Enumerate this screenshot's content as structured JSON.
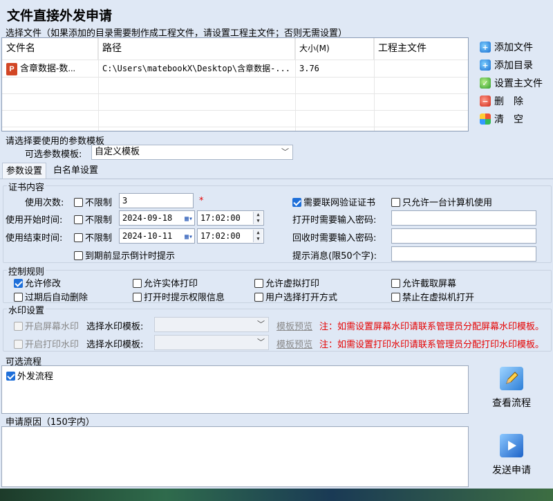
{
  "window": {
    "title": "文件直接外发申请"
  },
  "select_file": {
    "label": "选择文件（如果添加的目录需要制作成工程文件，请设置工程主文件；否则无需设置）",
    "columns": [
      "文件名",
      "路径",
      "大小(M)",
      "工程主文件"
    ],
    "rows": [
      {
        "name": "含章数据-数...",
        "path": "C:\\Users\\matebookX\\Desktop\\含章数据-...",
        "size": "3.76",
        "main": ""
      }
    ],
    "file_icon_letter": "P",
    "buttons": [
      {
        "label": "添加文件",
        "icon": "add-file-icon"
      },
      {
        "label": "添加目录",
        "icon": "add-folder-icon"
      },
      {
        "label": "设置主文件",
        "icon": "set-main-file-icon"
      },
      {
        "label": "删　除",
        "icon": "delete-icon"
      },
      {
        "label": "清　空",
        "icon": "clear-icon"
      }
    ]
  },
  "template": {
    "section_label": "请选择要使用的参数模板",
    "label": "可选参数模板:",
    "value": "自定义模板"
  },
  "tabs": [
    "参数设置",
    "白名单设置"
  ],
  "cert": {
    "title": "证书内容",
    "use_count_label": "使用次数:",
    "unlimited": "不限制",
    "use_count_value": "3",
    "required_mark": "*",
    "start_label": "使用开始时间:",
    "start_date": "2024-09-18",
    "start_time": "17:02:00",
    "end_label": "使用结束时间:",
    "end_date": "2024-10-11",
    "end_time": "17:02:00",
    "countdown": "到期前显示倒计时提示",
    "network_verify": "需要联网验证证书",
    "one_computer": "只允许一台计算机使用",
    "open_pwd_label": "打开时需要输入密码:",
    "recycle_pwd_label": "回收时需要输入密码:",
    "prompt_label": "提示消息(限50个字):"
  },
  "control": {
    "title": "控制规则",
    "items": [
      {
        "label": "允许修改",
        "checked": true
      },
      {
        "label": "允许实体打印",
        "checked": false
      },
      {
        "label": "允许虚拟打印",
        "checked": false
      },
      {
        "label": "允许截取屏幕",
        "checked": false
      },
      {
        "label": "过期后自动删除",
        "checked": false
      },
      {
        "label": "打开时提示权限信息",
        "checked": false
      },
      {
        "label": "用户选择打开方式",
        "checked": false
      },
      {
        "label": "禁止在虚拟机打开",
        "checked": false
      }
    ]
  },
  "watermark": {
    "title": "水印设置",
    "screen_label": "开启屏幕水印",
    "print_label": "开启打印水印",
    "select_label": "选择水印模板:",
    "preview": "模板预览",
    "screen_note": "注：如需设置屏幕水印请联系管理员分配屏幕水印模板。",
    "print_note": "注：如需设置打印水印请联系管理员分配打印水印模板。"
  },
  "flow": {
    "title": "可选流程",
    "item": "外发流程",
    "view_button": "查看流程"
  },
  "reason": {
    "title": "申请原因（150字内）",
    "send_button": "发送申请"
  },
  "colors": {
    "accent": "#1e6fd9",
    "warning": "#e60000",
    "background": "#dfe8f5"
  }
}
